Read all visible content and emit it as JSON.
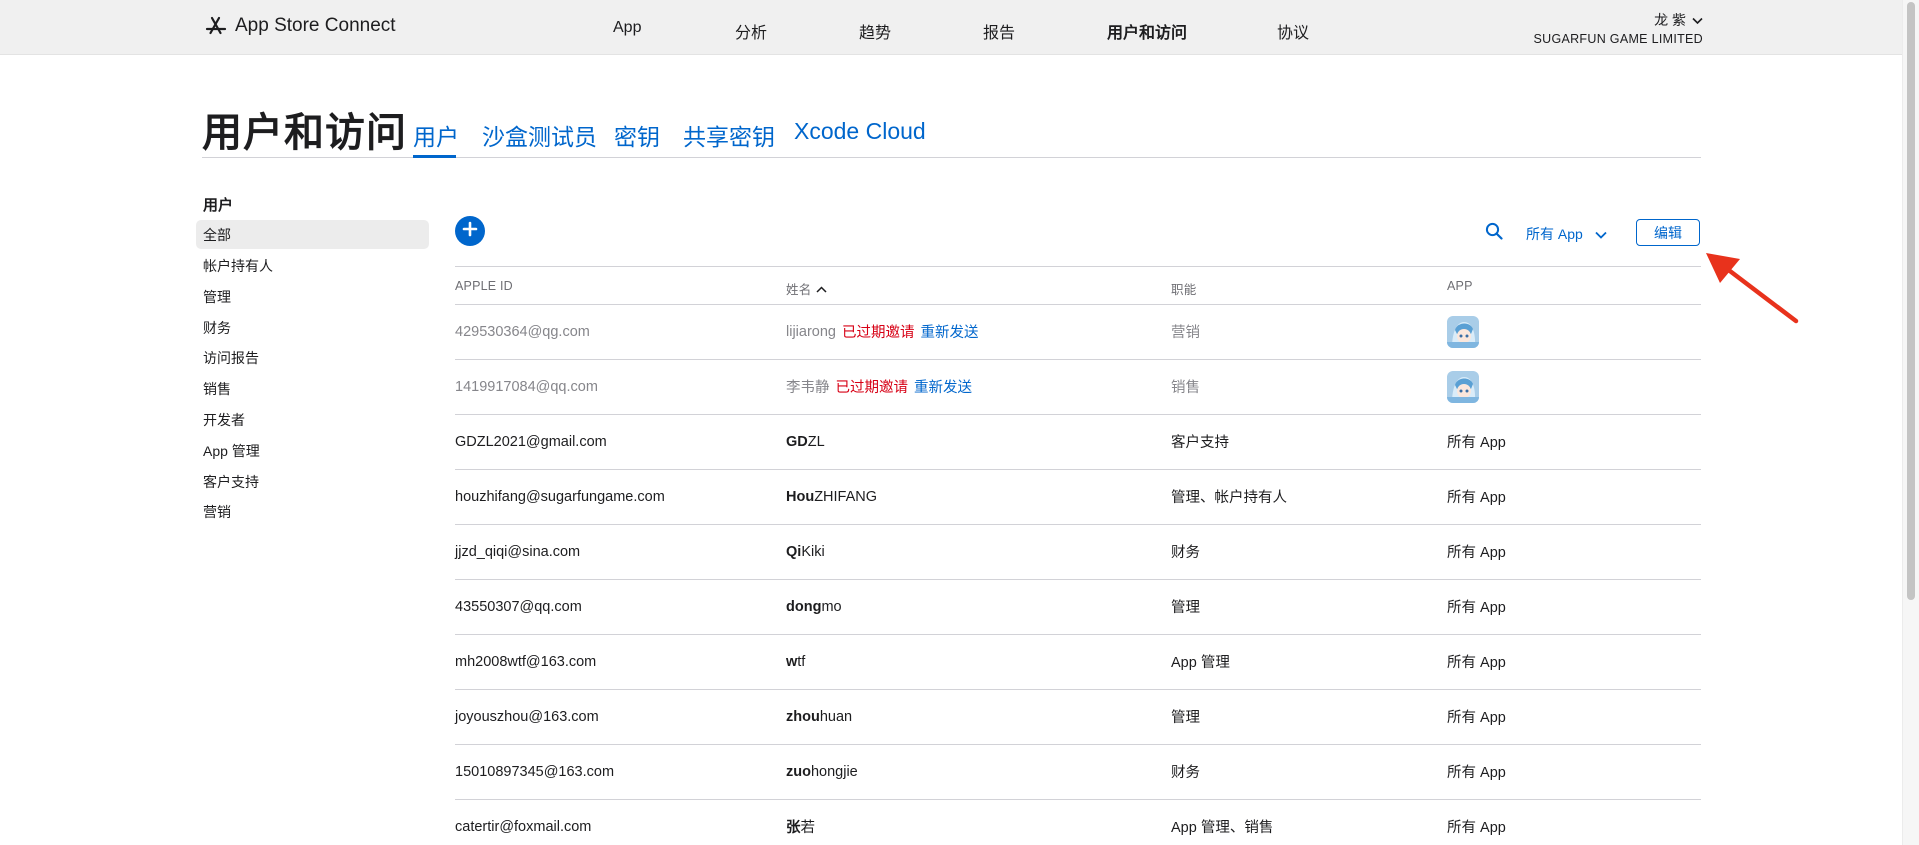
{
  "topbar": {
    "brand": "App Store Connect",
    "nav": [
      "App",
      "分析",
      "趋势",
      "报告",
      "用户和访问",
      "协议"
    ],
    "account_name": "龙 紫",
    "account_org": "SUGARFUN GAME LIMITED"
  },
  "header": {
    "title": "用户和访问",
    "tabs": [
      "用户",
      "沙盒测试员",
      "密钥",
      "共享密钥",
      "Xcode Cloud"
    ]
  },
  "sidebar": {
    "heading": "用户",
    "items": [
      "全部",
      "帐户持有人",
      "管理",
      "财务",
      "访问报告",
      "销售",
      "开发者",
      "App 管理",
      "客户支持",
      "营销"
    ]
  },
  "toolbar": {
    "filter_label": "所有 App",
    "edit_label": "编辑"
  },
  "table": {
    "columns": [
      "APPLE ID",
      "姓名",
      "职能",
      "APP"
    ],
    "invite_expired": "已过期邀请",
    "resend": "重新发送",
    "rows": [
      {
        "apple_id": "429530364@qg.com",
        "name_bold": "",
        "name_rest": "lijiarong",
        "role": "营销",
        "app": "",
        "pending": true
      },
      {
        "apple_id": "1419917084@qq.com",
        "name_bold": "",
        "name_rest": "李韦静",
        "role": "销售",
        "app": "",
        "pending": true
      },
      {
        "apple_id": "GDZL2021@gmail.com",
        "name_bold": "GD",
        "name_rest": "ZL",
        "role": "客户支持",
        "app": "所有 App",
        "pending": false
      },
      {
        "apple_id": "houzhifang@sugarfungame.com",
        "name_bold": "Hou",
        "name_rest": "ZHIFANG",
        "role": "管理、帐户持有人",
        "app": "所有 App",
        "pending": false
      },
      {
        "apple_id": "jjzd_qiqi@sina.com",
        "name_bold": "Qi",
        "name_rest": "Kiki",
        "role": "财务",
        "app": "所有 App",
        "pending": false
      },
      {
        "apple_id": "43550307@qq.com",
        "name_bold": "dong",
        "name_rest": "mo",
        "role": "管理",
        "app": "所有 App",
        "pending": false
      },
      {
        "apple_id": "mh2008wtf@163.com",
        "name_bold": "w",
        "name_rest": "tf",
        "role": "App 管理",
        "app": "所有 App",
        "pending": false
      },
      {
        "apple_id": "joyouszhou@163.com",
        "name_bold": "zhou",
        "name_rest": "huan",
        "role": "管理",
        "app": "所有 App",
        "pending": false
      },
      {
        "apple_id": "15010897345@163.com",
        "name_bold": "zuo",
        "name_rest": "hongjie",
        "role": "财务",
        "app": "所有 App",
        "pending": false
      },
      {
        "apple_id": "catertir@foxmail.com",
        "name_bold": "张",
        "name_rest": "若",
        "role": "App 管理、销售",
        "app": "所有 App",
        "pending": false
      }
    ]
  },
  "colors": {
    "accent": "#0066cc",
    "expired": "#d70015",
    "annotation_arrow": "#e8321c"
  }
}
